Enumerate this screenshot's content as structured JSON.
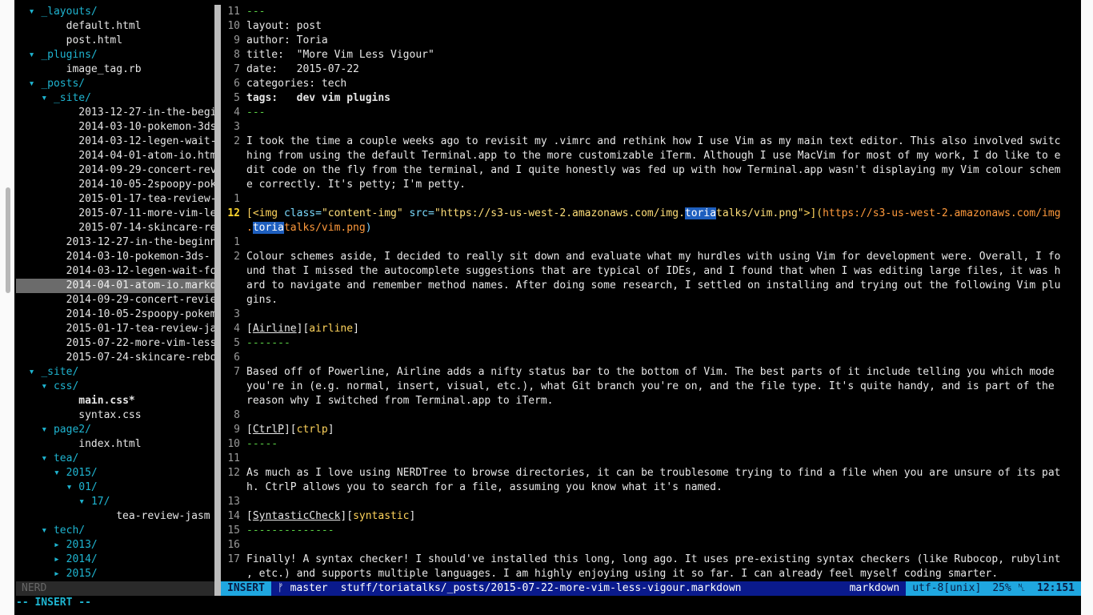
{
  "tree": [
    {
      "indent": 2,
      "arrow": "▾",
      "text": "_layouts/",
      "type": "dir"
    },
    {
      "indent": 4,
      "arrow": "",
      "text": "default.html",
      "type": "file"
    },
    {
      "indent": 4,
      "arrow": "",
      "text": "post.html",
      "type": "file"
    },
    {
      "indent": 2,
      "arrow": "▾",
      "text": "_plugins/",
      "type": "dir"
    },
    {
      "indent": 4,
      "arrow": "",
      "text": "image_tag.rb",
      "type": "file"
    },
    {
      "indent": 2,
      "arrow": "▾",
      "text": "_posts/",
      "type": "dir"
    },
    {
      "indent": 3,
      "arrow": "▾",
      "text": "_site/",
      "type": "dir"
    },
    {
      "indent": 5,
      "arrow": "",
      "text": "2013-12-27-in-the-begi",
      "type": "file"
    },
    {
      "indent": 5,
      "arrow": "",
      "text": "2014-03-10-pokemon-3ds",
      "type": "file"
    },
    {
      "indent": 5,
      "arrow": "",
      "text": "2014-03-12-legen-wait-",
      "type": "file"
    },
    {
      "indent": 5,
      "arrow": "",
      "text": "2014-04-01-atom-io.htm",
      "type": "file"
    },
    {
      "indent": 5,
      "arrow": "",
      "text": "2014-09-29-concert-rev",
      "type": "file"
    },
    {
      "indent": 5,
      "arrow": "",
      "text": "2014-10-05-2spoopy-pok",
      "type": "file"
    },
    {
      "indent": 5,
      "arrow": "",
      "text": "2015-01-17-tea-review-",
      "type": "file"
    },
    {
      "indent": 5,
      "arrow": "",
      "text": "2015-07-11-more-vim-le",
      "type": "file"
    },
    {
      "indent": 5,
      "arrow": "",
      "text": "2015-07-14-skincare-re",
      "type": "file"
    },
    {
      "indent": 4,
      "arrow": "",
      "text": "2013-12-27-in-the-beginn",
      "type": "file"
    },
    {
      "indent": 4,
      "arrow": "",
      "text": "2014-03-10-pokemon-3ds-",
      "type": "file"
    },
    {
      "indent": 4,
      "arrow": "",
      "text": "2014-03-12-legen-wait-fo",
      "type": "file"
    },
    {
      "indent": 4,
      "arrow": "",
      "text": "2014-04-01-atom-io.markd",
      "type": "file",
      "selected": true
    },
    {
      "indent": 4,
      "arrow": "",
      "text": "2014-09-29-concert-revie",
      "type": "file"
    },
    {
      "indent": 4,
      "arrow": "",
      "text": "2014-10-05-2spoopy-pokem",
      "type": "file"
    },
    {
      "indent": 4,
      "arrow": "",
      "text": "2015-01-17-tea-review-ja",
      "type": "file"
    },
    {
      "indent": 4,
      "arrow": "",
      "text": "2015-07-22-more-vim-less",
      "type": "file"
    },
    {
      "indent": 4,
      "arrow": "",
      "text": "2015-07-24-skincare-rebo",
      "type": "file"
    },
    {
      "indent": 2,
      "arrow": "▾",
      "text": "_site/",
      "type": "dir"
    },
    {
      "indent": 3,
      "arrow": "▾",
      "text": "css/",
      "type": "dir"
    },
    {
      "indent": 5,
      "arrow": "",
      "text": "main.css*",
      "type": "file",
      "bold": true
    },
    {
      "indent": 5,
      "arrow": "",
      "text": "syntax.css",
      "type": "file"
    },
    {
      "indent": 3,
      "arrow": "▾",
      "text": "page2/",
      "type": "dir"
    },
    {
      "indent": 5,
      "arrow": "",
      "text": "index.html",
      "type": "file"
    },
    {
      "indent": 3,
      "arrow": "▾",
      "text": "tea/",
      "type": "dir"
    },
    {
      "indent": 4,
      "arrow": "▾",
      "text": "2015/",
      "type": "dir"
    },
    {
      "indent": 5,
      "arrow": "▾",
      "text": "01/",
      "type": "dir"
    },
    {
      "indent": 6,
      "arrow": "▾",
      "text": "17/",
      "type": "dir"
    },
    {
      "indent": 8,
      "arrow": "",
      "text": "tea-review-jasm",
      "type": "file"
    },
    {
      "indent": 3,
      "arrow": "▾",
      "text": "tech/",
      "type": "dir"
    },
    {
      "indent": 4,
      "arrow": "▸",
      "text": "2013/",
      "type": "dir"
    },
    {
      "indent": 4,
      "arrow": "▸",
      "text": "2014/",
      "type": "dir"
    },
    {
      "indent": 4,
      "arrow": "▸",
      "text": "2015/",
      "type": "dir"
    }
  ],
  "nerd_label": "NERD",
  "editor_lines": [
    {
      "ln": "11",
      "segs": [
        {
          "t": "---",
          "c": "c-dash"
        }
      ]
    },
    {
      "ln": "10",
      "segs": [
        {
          "t": "layout: post"
        }
      ]
    },
    {
      "ln": "9",
      "segs": [
        {
          "t": "author: Toria"
        }
      ]
    },
    {
      "ln": "8",
      "segs": [
        {
          "t": "title:  \"More Vim Less Vigour\""
        }
      ]
    },
    {
      "ln": "7",
      "segs": [
        {
          "t": "date:   2015-07-22"
        }
      ]
    },
    {
      "ln": "6",
      "segs": [
        {
          "t": "categories: tech"
        }
      ]
    },
    {
      "ln": "5",
      "segs": [
        {
          "t": "tags:   dev vim plugins",
          "c": "c-bold"
        }
      ]
    },
    {
      "ln": "4",
      "segs": [
        {
          "t": "---",
          "c": "c-dash"
        }
      ]
    },
    {
      "ln": "3",
      "segs": []
    },
    {
      "ln": "2",
      "segs": [
        {
          "t": "I took the time a couple weeks ago to revisit my .vimrc and rethink how I use Vim as my main text editor. This also involved switc"
        }
      ]
    },
    {
      "ln": "",
      "segs": [
        {
          "t": "hing from using the default Terminal.app to the more customizable iTerm. Although I use MacVim for most of my work, I do like to e"
        }
      ]
    },
    {
      "ln": "",
      "segs": [
        {
          "t": "dit code on the fly from the terminal, and I quite honestly was fed up with how Terminal.app wasn't displaying my Vim colour schem"
        }
      ]
    },
    {
      "ln": "",
      "segs": [
        {
          "t": "e correctly. It's petty; I'm petty."
        }
      ]
    },
    {
      "ln": "1",
      "segs": []
    },
    {
      "ln": "12",
      "cur": true,
      "segs": [
        {
          "t": "[<img ",
          "c": "c-ref"
        },
        {
          "t": "class=",
          "c": "c-attr"
        },
        {
          "t": "\"content-img\"",
          "c": "c-str"
        },
        {
          "t": " src=",
          "c": "c-attr"
        },
        {
          "t": "\"https://s3-us-west-2.amazonaws.com/img.",
          "c": "c-str"
        },
        {
          "t": "toria",
          "c": "c-hl"
        },
        {
          "t": "talks/vim.png\"",
          "c": "c-str"
        },
        {
          "t": ">](",
          "c": "c-ref"
        },
        {
          "t": "https://s3-us-west-2.amazonaws.com/img",
          "c": "c-url"
        }
      ]
    },
    {
      "ln": "",
      "segs": [
        {
          "t": ".",
          "c": "c-url"
        },
        {
          "t": "toria",
          "c": "c-hl"
        },
        {
          "t": "talks/vim.png",
          "c": "c-url"
        },
        {
          "t": ")",
          "c": "c-paren"
        }
      ]
    },
    {
      "ln": "1",
      "segs": []
    },
    {
      "ln": "2",
      "segs": [
        {
          "t": "Colour schemes aside, I decided to really sit down and evaluate what my hurdles with using Vim for development were. Overall, I fo"
        }
      ]
    },
    {
      "ln": "",
      "segs": [
        {
          "t": "und that I missed the autocomplete suggestions that are typical of IDEs, and I found that when I was editing large files, it was h"
        }
      ]
    },
    {
      "ln": "",
      "segs": [
        {
          "t": "ard to navigate and remember method names. After doing some research, I settled on installing and trying out the following Vim plu"
        }
      ]
    },
    {
      "ln": "",
      "segs": [
        {
          "t": "gins."
        }
      ]
    },
    {
      "ln": "3",
      "segs": []
    },
    {
      "ln": "4",
      "segs": [
        {
          "t": "["
        },
        {
          "t": "Airline",
          "c": "c-ul"
        },
        {
          "t": "]["
        },
        {
          "t": "airline",
          "c": "c-ref"
        },
        {
          "t": "]"
        }
      ]
    },
    {
      "ln": "5",
      "segs": [
        {
          "t": "-------",
          "c": "c-dash"
        }
      ]
    },
    {
      "ln": "6",
      "segs": []
    },
    {
      "ln": "7",
      "segs": [
        {
          "t": "Based off of Powerline, Airline adds a nifty status bar to the bottom of Vim. The best parts of it include telling you which mode"
        }
      ]
    },
    {
      "ln": "",
      "segs": [
        {
          "t": "you're in (e.g. normal, insert, visual, etc.), what Git branch you're on, and the file type. It's quite handy, and is part of the"
        }
      ]
    },
    {
      "ln": "",
      "segs": [
        {
          "t": "reason why I switched from Terminal.app to iTerm."
        }
      ]
    },
    {
      "ln": "8",
      "segs": []
    },
    {
      "ln": "9",
      "segs": [
        {
          "t": "["
        },
        {
          "t": "CtrlP",
          "c": "c-ul"
        },
        {
          "t": "]["
        },
        {
          "t": "ctrlp",
          "c": "c-ref"
        },
        {
          "t": "]"
        }
      ]
    },
    {
      "ln": "10",
      "segs": [
        {
          "t": "-----",
          "c": "c-dash"
        }
      ]
    },
    {
      "ln": "11",
      "segs": []
    },
    {
      "ln": "12",
      "segs": [
        {
          "t": "As much as I love using NERDTree to browse directories, it can be troublesome trying to find a file when you are unsure of its pat"
        }
      ]
    },
    {
      "ln": "",
      "segs": [
        {
          "t": "h. CtrlP allows you to search for a file, assuming you know what it's named."
        }
      ]
    },
    {
      "ln": "13",
      "segs": []
    },
    {
      "ln": "14",
      "segs": [
        {
          "t": "["
        },
        {
          "t": "SyntasticCheck",
          "c": "c-ul"
        },
        {
          "t": "]["
        },
        {
          "t": "syntastic",
          "c": "c-ref"
        },
        {
          "t": "]"
        }
      ]
    },
    {
      "ln": "15",
      "segs": [
        {
          "t": "--------------",
          "c": "c-dash"
        }
      ]
    },
    {
      "ln": "16",
      "segs": []
    },
    {
      "ln": "17",
      "segs": [
        {
          "t": "Finally! A syntax checker! I should've installed this long, long ago. It uses pre-existing syntax checkers (like Rubocop, rubylint"
        }
      ]
    },
    {
      "ln": "",
      "segs": [
        {
          "t": ", etc.) and supports multiple languages. I am highly enjoying using it so far. I can already feel myself coding smarter."
        }
      ]
    }
  ],
  "status": {
    "mode": "INSERT",
    "branch": "ᚠ master",
    "path": "stuff/toriatalks/_posts/2015-07-22-more-vim-less-vigour.markdown",
    "filetype": "markdown",
    "encoding": "utf-8[unix]",
    "percent": "25% ␤",
    "position": "12:151"
  },
  "cmdline": "-- INSERT --",
  "colors": {
    "accent": "#1fb5d1",
    "statusbar": "#0a1a8c",
    "mode": "#1fa7e0",
    "dash": "#5bd246"
  }
}
